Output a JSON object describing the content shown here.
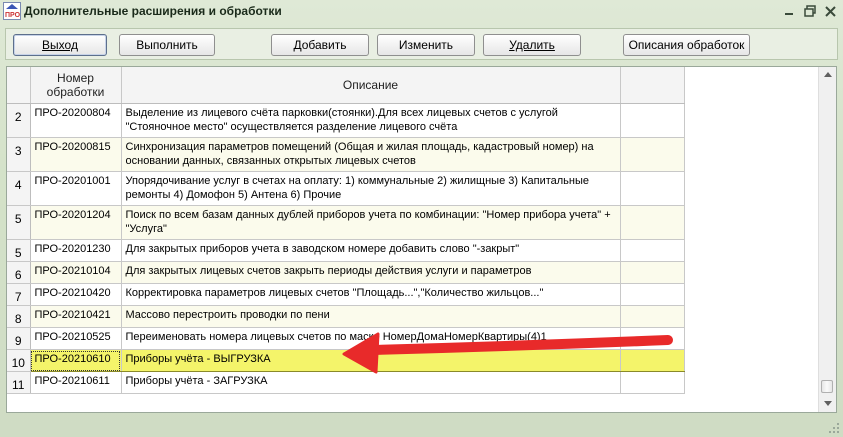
{
  "window": {
    "title": "Дополнительные расширения и обработки",
    "icon_text": "ПРО"
  },
  "toolbar": {
    "exit": "Выход",
    "run": "Выполнить",
    "add": "Добавить",
    "edit": "Изменить",
    "delete": "Удалить",
    "descriptions": "Описания обработок"
  },
  "table": {
    "headers": {
      "number": "Номер обработки",
      "description": "Описание"
    },
    "rows": [
      {
        "n": "2",
        "code": "ПРО-20200804",
        "desc": "Выделение из лицевого счёта парковки(стоянки).Для всех лицевых счетов с услугой \"Стояночное место\" осуществляется разделение лицевого счёта"
      },
      {
        "n": "3",
        "code": "ПРО-20200815",
        "desc": "Синхронизация параметров помещений (Общая и жилая площадь, кадастровый номер) на основании данных, связанных открытых лицевых счетов"
      },
      {
        "n": "4",
        "code": "ПРО-20201001",
        "desc": "Упорядочивание услуг в счетах на оплату: 1) коммунальные  2) жилищные 3) Капитальные ремонты 4) Домофон 5) Антена 6) Прочие"
      },
      {
        "n": "5",
        "code": "ПРО-20201204",
        "desc": "Поиск по всем базам данных дублей приборов учета по комбинации: \"Номер прибора учета\" + \"Услуга\""
      },
      {
        "n": "5",
        "code": "ПРО-20201230",
        "desc": "Для закрытых приборов учета в заводском номере добавить слово \"-закрыт\""
      },
      {
        "n": "6",
        "code": "ПРО-20210104",
        "desc": "Для закрытых лицевых счетов закрыть периоды действия услуги и параметров"
      },
      {
        "n": "7",
        "code": "ПРО-20210420",
        "desc": "Корректировка параметров лицевых счетов \"Площадь...\",\"Количество жильцов...\""
      },
      {
        "n": "8",
        "code": "ПРО-20210421",
        "desc": "Массово перестроить проводки по пени"
      },
      {
        "n": "9",
        "code": "ПРО-20210525",
        "desc": "Переименовать номера лицевых счетов по маске НомерДомаНомерКвартиры(4)1"
      },
      {
        "n": "10",
        "code": "ПРО-20210610",
        "desc": "Приборы учёта - ВЫГРУЗКА"
      },
      {
        "n": "11",
        "code": "ПРО-20210611",
        "desc": "Приборы учёта - ЗАГРУЗКА"
      }
    ],
    "selected_index": 9
  },
  "colors": {
    "selected_row": "#f4f46a",
    "alt_row": "#fbfbec",
    "arrow": "#e82a2a"
  }
}
